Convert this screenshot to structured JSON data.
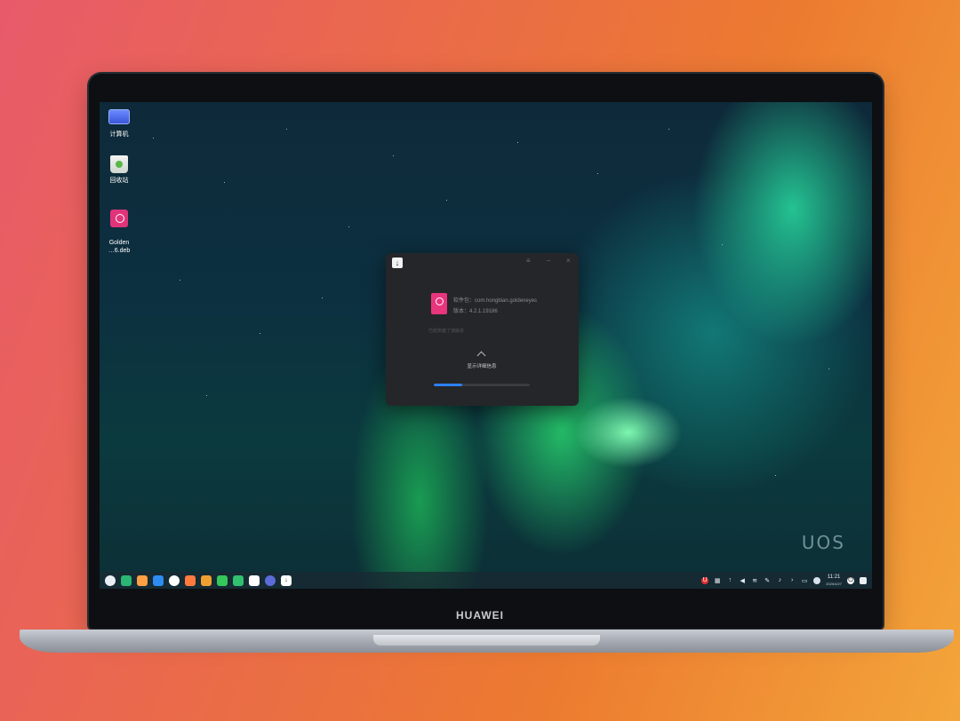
{
  "device": {
    "brand": "HUAWEI"
  },
  "desktop": {
    "watermark": "UOS",
    "icons": [
      {
        "label": "计算机",
        "icon": "computer-icon"
      },
      {
        "label": "回收站",
        "icon": "trash-icon"
      },
      {
        "label": "Golden\n…6.deb",
        "icon": "deb-package-icon"
      }
    ]
  },
  "installer": {
    "package_name": "软件包：com.hongbian.goldeneyes",
    "version": "版本：4.2.1.19186",
    "status": "已经安装了该版本",
    "detail_button": "显示详细信息",
    "progress": 0.3,
    "accent": "#2d7ff9"
  },
  "taskbar": {
    "apps": [
      {
        "name": "launcher",
        "color": "#e9eef5"
      },
      {
        "name": "multitask-view",
        "color": "#2bb673"
      },
      {
        "name": "file-manager",
        "color": "#ff9f43"
      },
      {
        "name": "app-store",
        "color": "#2d8cf0"
      },
      {
        "name": "browser",
        "color": "#ffffff"
      },
      {
        "name": "mail",
        "color": "#ff7a3d"
      },
      {
        "name": "photo-viewer",
        "color": "#f0a030"
      },
      {
        "name": "music",
        "color": "#34c759"
      },
      {
        "name": "terminal",
        "color": "#30c070"
      },
      {
        "name": "calendar",
        "color": "#ffffff"
      },
      {
        "name": "control-center",
        "color": "#5b6bd8"
      },
      {
        "name": "installer",
        "color": "#ffffff"
      }
    ],
    "clock_time": "11:21",
    "clock_date": "2020/4/27"
  }
}
